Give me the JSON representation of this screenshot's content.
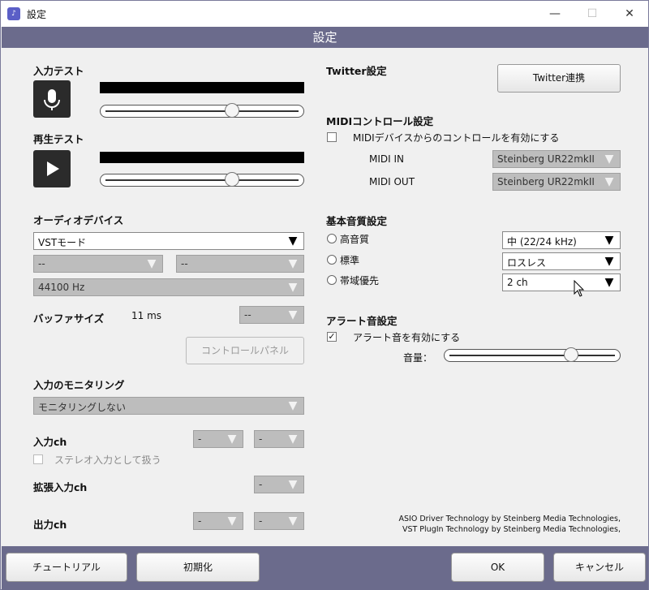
{
  "window": {
    "title": "設定",
    "controls": {
      "minimize": "—",
      "maximize": "☐",
      "close": "✕"
    }
  },
  "header": {
    "title": "設定"
  },
  "left": {
    "input_test": {
      "label": "入力テスト"
    },
    "playback_test": {
      "label": "再生テスト"
    },
    "audio_device": {
      "label": "オーディオデバイス",
      "mode": "VSTモード",
      "dev1": "--",
      "dev2": "--",
      "rate": "44100 Hz"
    },
    "buffer": {
      "label": "バッファサイズ",
      "value": "11 ms",
      "select": "--"
    },
    "control_panel_label": "コントロールパネル",
    "monitoring": {
      "label": "入力のモニタリング",
      "value": "モニタリングしない"
    },
    "input_ch": {
      "label": "入力ch",
      "a": "-",
      "b": "-",
      "stereo_label": "ステレオ入力として扱う"
    },
    "ext_input_ch": {
      "label": "拡張入力ch",
      "value": "-"
    },
    "output_ch": {
      "label": "出力ch",
      "a": "-",
      "b": "-"
    }
  },
  "right": {
    "twitter": {
      "label": "Twitter設定",
      "button": "Twitter連携"
    },
    "midi": {
      "label": "MIDIコントロール設定",
      "enable_label": "MIDIデバイスからのコントロールを有効にする",
      "in_label": "MIDI IN",
      "in_value": "Steinberg UR22mkII",
      "out_label": "MIDI OUT",
      "out_value": "Steinberg UR22mkII"
    },
    "quality": {
      "label": "基本音質設定",
      "options": [
        "高音質",
        "標準",
        "帯域優先"
      ],
      "values": [
        "中 (22/24 kHz)",
        "ロスレス",
        "2 ch"
      ]
    },
    "alert": {
      "label": "アラート音設定",
      "enable_label": "アラート音を有効にする",
      "checked": true,
      "volume_label": "音量：",
      "volume": 0.74
    },
    "credits": [
      "ASIO Driver Technology by Steinberg Media Technologies,",
      "VST PlugIn Technology by Steinberg Media Technologies,"
    ]
  },
  "levels": {
    "input": 0.66,
    "playback": 0.66
  },
  "footer": {
    "tutorial": "チュートリアル",
    "reset": "初期化",
    "ok": "OK",
    "cancel": "キャンセル"
  }
}
